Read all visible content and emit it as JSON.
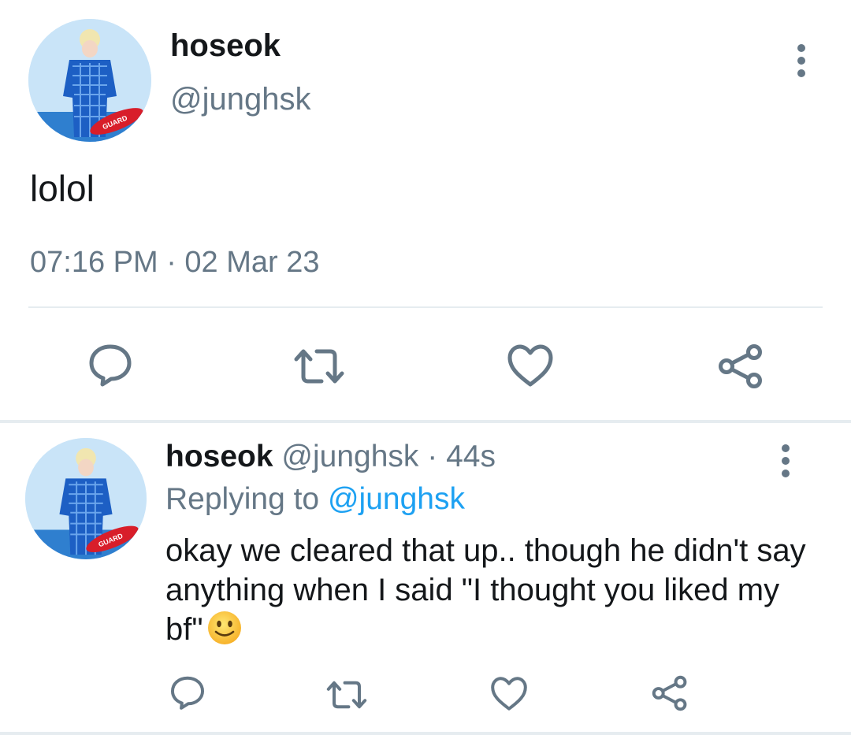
{
  "main_tweet": {
    "author_name": "hoseok",
    "author_handle": "@junghsk",
    "text": "lolol",
    "timestamp": "07:16 PM · 02 Mar 23",
    "avatar_badge": "GUARD",
    "icons": [
      "reply-icon",
      "retweet-icon",
      "like-icon",
      "share-icon",
      "more-options-icon"
    ]
  },
  "reply_tweet": {
    "author_name": "hoseok",
    "author_handle": "@junghsk",
    "separator": "·",
    "age": "44s",
    "replying_prefix": "Replying to",
    "replying_to": "@junghsk",
    "text": "okay we cleared that up.. though he didn't say anything when I said \"I thought you liked my bf\"",
    "emoji": "slightly-smiling-face",
    "avatar_badge": "GUARD",
    "icons": [
      "reply-icon",
      "retweet-icon",
      "like-icon",
      "share-icon",
      "more-options-icon"
    ]
  },
  "colors": {
    "text_primary": "#14171a",
    "text_secondary": "#657786",
    "mention": "#1da1f2",
    "divider": "#e6ecf0"
  }
}
